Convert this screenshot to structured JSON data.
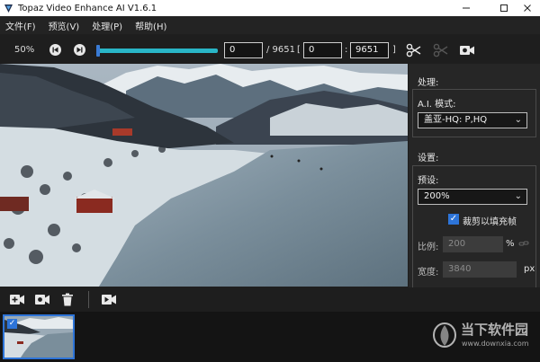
{
  "window": {
    "title": "Topaz Video Enhance AI V1.6.1",
    "controls": [
      "minimize-icon",
      "maximize-icon",
      "close-icon"
    ]
  },
  "menu": [
    {
      "label": "文件(F)"
    },
    {
      "label": "预览(V)"
    },
    {
      "label": "处理(P)"
    },
    {
      "label": "帮助(H)"
    }
  ],
  "toolbar": {
    "zoom": "50%",
    "current_frame": "0",
    "total_frames": "/ 9651",
    "range_open": "[",
    "range_start": "0",
    "range_sep": ":",
    "range_end": "9651",
    "range_close": "]",
    "timeline_position": 0.0,
    "icons": [
      "previous-frame-icon",
      "next-frame-icon",
      "cut-icon",
      "cut-disabled-icon",
      "preview-camera-icon"
    ]
  },
  "panel": {
    "processing_title": "处理:",
    "ai_model_label": "A.I. 模式:",
    "ai_model_value": "盖亚-HQ: P,HQ",
    "settings_title": "设置:",
    "preset_label": "预设:",
    "preset_value": "200%",
    "crop_checked": true,
    "crop_label": "裁剪以填充帧",
    "scale_label": "比例:",
    "scale_value": "200",
    "scale_unit": "%",
    "width_label": "宽度:",
    "width_value": "3840",
    "width_unit": "px"
  },
  "bottombar": {
    "icons": [
      "add-video-icon",
      "video-settings-icon",
      "delete-icon",
      "export-video-icon"
    ]
  },
  "filmstrip": {
    "items": [
      {
        "selected": true
      }
    ]
  },
  "watermark": {
    "line1": "当下软件园",
    "line2": "www.downxia.com"
  },
  "colors": {
    "accent": "#2d74d8",
    "timeline": "#29b6c7",
    "background": "#1e1e1e"
  }
}
